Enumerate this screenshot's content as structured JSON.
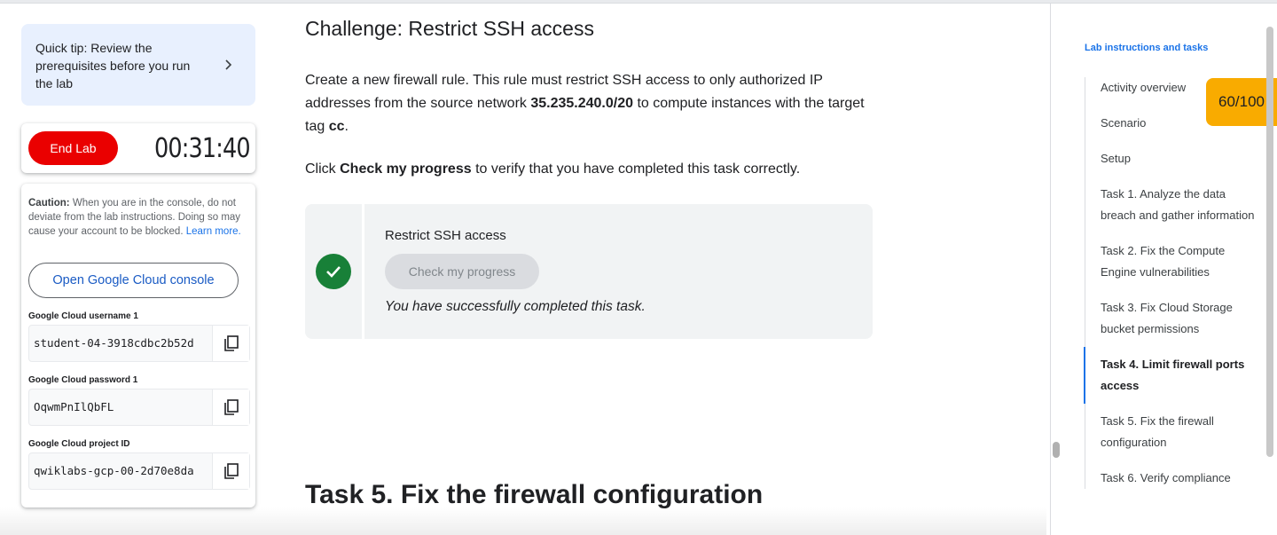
{
  "tip": {
    "text": "Quick tip: Review the prerequisites before you run the lab"
  },
  "timer": {
    "end_label": "End Lab",
    "time": "00:31:40"
  },
  "caution": {
    "label": "Caution:",
    "text": " When you are in the console, do not deviate from the lab instructions. Doing so may cause your account to be blocked.",
    "link": "Learn more."
  },
  "console_button": "Open Google Cloud console",
  "credentials": [
    {
      "label": "Google Cloud username 1",
      "value": "student-04-3918cdbc2b52d"
    },
    {
      "label": "Google Cloud password 1",
      "value": "OqwmPnIlQbFL"
    },
    {
      "label": "Google Cloud project ID",
      "value": "qwiklabs-gcp-00-2d70e8da"
    }
  ],
  "main": {
    "heading": "Challenge: Restrict SSH access",
    "para_1": "Create a new firewall rule. This rule must restrict SSH access to only authorized IP addresses from the source network ",
    "para_ip": "35.235.240.0/20",
    "para_2": " to compute instances with the target tag ",
    "para_tag": "cc",
    "para_end": ".",
    "click_pre": "Click ",
    "click_bold": "Check my progress",
    "click_post": " to verify that you have completed this task correctly.",
    "task_title": "Restrict SSH access",
    "progress_button": "Check my progress",
    "task_success": "You have successfully completed this task.",
    "next_heading": "Task 5. Fix the firewall configuration"
  },
  "toc": {
    "heading": "Lab instructions and tasks",
    "items": [
      {
        "label": "Activity overview"
      },
      {
        "label": "Scenario"
      },
      {
        "label": "Setup"
      },
      {
        "label": "Task 1. Analyze the data breach and gather information"
      },
      {
        "label": "Task 2. Fix the Compute Engine vulnerabilities"
      },
      {
        "label": "Task 3. Fix Cloud Storage bucket permissions"
      },
      {
        "label": "Task 4. Limit firewall ports access"
      },
      {
        "label": "Task 5. Fix the firewall configuration"
      },
      {
        "label": "Task 6. Verify compliance"
      }
    ],
    "active_index": 6
  },
  "score": "60/100",
  "colors": {
    "accent": "#1a73e8",
    "end_button": "#ea0000",
    "success": "#188038",
    "score_bg": "#f9ab00"
  },
  "icons": {
    "tip": "chevron-right-icon",
    "copy": "copy-icon",
    "task_status": "check-circle-icon"
  }
}
